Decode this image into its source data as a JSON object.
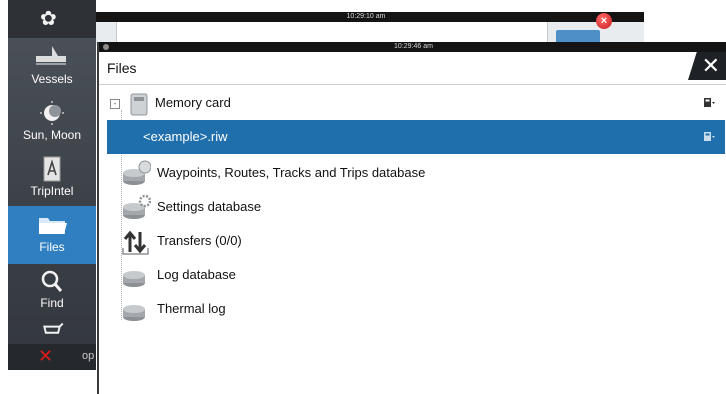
{
  "back_window": {
    "time": "10:29:10 am",
    "close_symbol": "×"
  },
  "sidebar": {
    "top_icon": "gear-icon",
    "items": [
      {
        "label": "Vessels",
        "icon": "vessels-icon"
      },
      {
        "label": "Sun, Moon",
        "icon": "sun-moon-icon"
      },
      {
        "label": "TripIntel",
        "icon": "tripintel-icon"
      },
      {
        "label": "Files",
        "icon": "folder-icon",
        "active": true
      },
      {
        "label": "Find",
        "icon": "magnifier-icon"
      },
      {
        "label": "",
        "icon": "cart-icon"
      }
    ],
    "bottom": {
      "close_symbol": "✕",
      "label_fragment": "op"
    }
  },
  "dialog": {
    "status_time": "10:29:46 am",
    "title": "Files",
    "close_symbol": "✕",
    "expander_symbol": "-",
    "tree": [
      {
        "label": "Memory card",
        "icon": "memory-card-icon",
        "selected": false
      },
      {
        "label": "<example>.riw",
        "icon": "",
        "selected": true
      },
      {
        "label": "Waypoints, Routes, Tracks and Trips database",
        "icon": "database-waypoints-icon",
        "selected": false
      },
      {
        "label": "Settings database",
        "icon": "database-settings-icon",
        "selected": false
      },
      {
        "label": "Transfers (0/0)",
        "icon": "transfers-icon",
        "selected": false
      },
      {
        "label": "Log database",
        "icon": "database-icon",
        "selected": false
      },
      {
        "label": "Thermal log",
        "icon": "database-icon",
        "selected": false
      }
    ]
  },
  "colors": {
    "sidebar": "#3f444b",
    "active": "#2f7fc1",
    "selection": "#1f6fad",
    "close_red": "#e01b1b"
  }
}
